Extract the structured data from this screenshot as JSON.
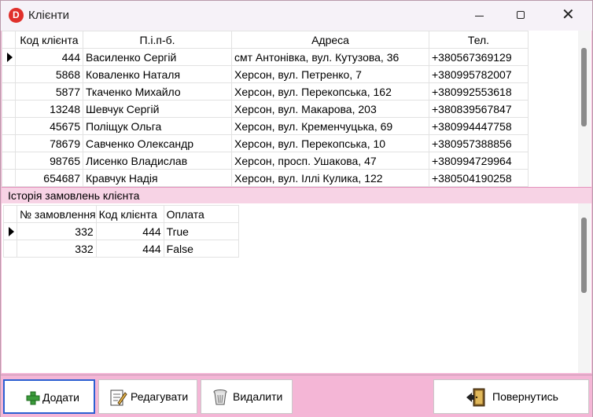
{
  "window": {
    "title": "Клієнти",
    "app_icon_letter": "D",
    "buttons": [
      "minimize",
      "maximize",
      "close"
    ]
  },
  "clients": {
    "columns": [
      "Код клієнта",
      "П.і.п-б.",
      "Адреса",
      "Тел."
    ],
    "rows": [
      {
        "id": "444",
        "name": "Василенко Сергій",
        "address": "смт Антонівка, вул. Кутузова, 36",
        "phone": "+380567369129",
        "current": true
      },
      {
        "id": "5868",
        "name": "Коваленко Наталя",
        "address": "Херсон, вул. Петренко, 7",
        "phone": "+380995782007",
        "current": false
      },
      {
        "id": "5877",
        "name": "Ткаченко Михайло",
        "address": "Херсон, вул. Перекопська, 162",
        "phone": "+380992553618",
        "current": false
      },
      {
        "id": "13248",
        "name": "Шевчук Сергій",
        "address": "Херсон, вул. Макарова, 203",
        "phone": "+380839567847",
        "current": false
      },
      {
        "id": "45675",
        "name": "Поліщук Ольга",
        "address": "Херсон, вул. Кременчуцька, 69",
        "phone": "+380994447758",
        "current": false
      },
      {
        "id": "78679",
        "name": "Савченко Олександр",
        "address": "Херсон, вул. Перекопська, 10",
        "phone": "+380957388856",
        "current": false
      },
      {
        "id": "98765",
        "name": "Лисенко Владислав",
        "address": "Херсон, просп. Ушакова, 47",
        "phone": "+380994729964",
        "current": false
      },
      {
        "id": "654687",
        "name": "Кравчук Надія",
        "address": "Херсон, вул. Іллі Кулика, 122",
        "phone": "+380504190258",
        "current": false
      }
    ]
  },
  "orders": {
    "section_title": "Історія замовлень клієнта",
    "columns": [
      "№ замовлення",
      "Код клієнта",
      "Оплата"
    ],
    "rows": [
      {
        "order": "332",
        "client": "444",
        "paid": "True",
        "current": true
      },
      {
        "order": "332",
        "client": "444",
        "paid": "False",
        "current": false
      }
    ]
  },
  "toolbar": {
    "add_label": "Додати",
    "edit_label": "Редагувати",
    "delete_label": "Видалити",
    "back_label": "Повернутись"
  },
  "colors": {
    "background": "#f4b6d6",
    "section_header": "#f7d3e5",
    "selected_button_border": "#2b5fd1"
  }
}
